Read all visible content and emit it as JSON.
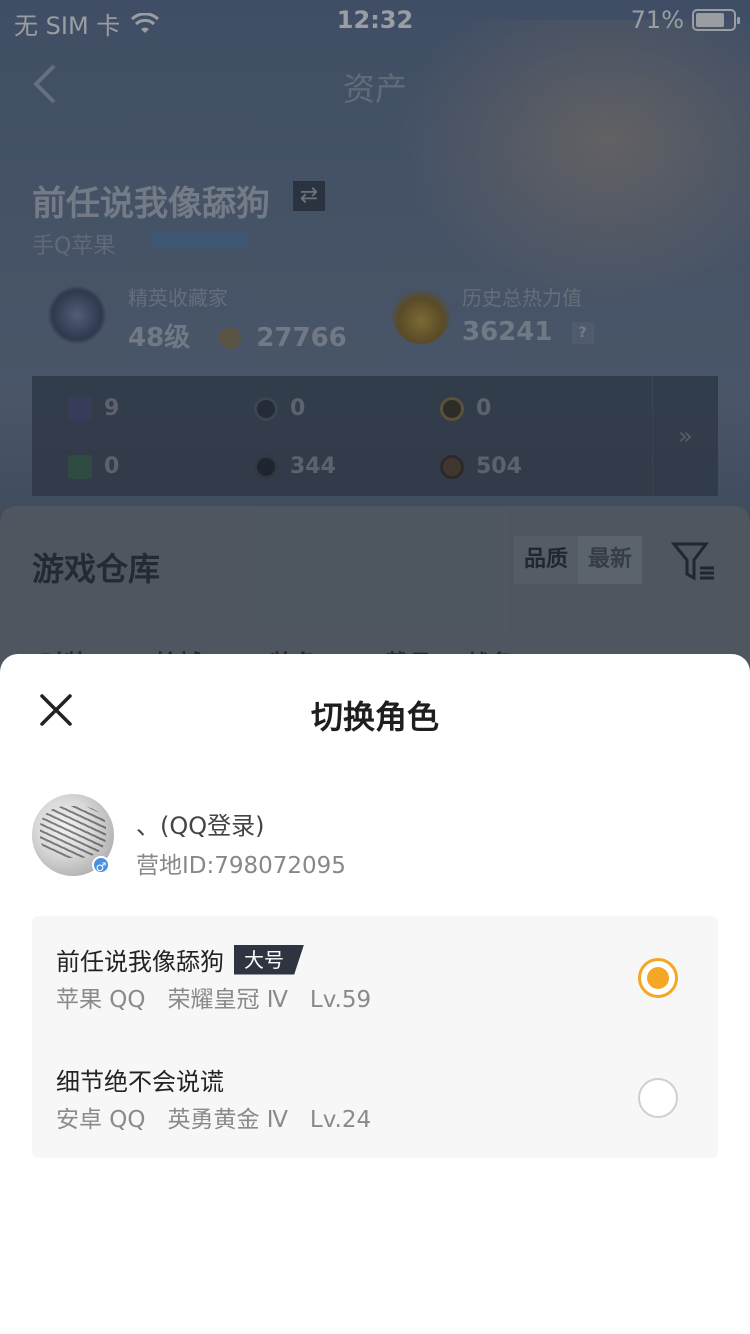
{
  "status_bar": {
    "carrier": "无 SIM 卡",
    "time": "12:32",
    "battery_percent": "71%",
    "battery_level": 0.71
  },
  "nav": {
    "title": "资产",
    "back_icon": "chevron-left-icon"
  },
  "profile": {
    "name": "前任说我像舔狗",
    "platform": "手Q苹果",
    "collector_label": "精英收藏家",
    "collector_level": "48级",
    "collector_points": "27766",
    "heat_label": "历史总热力值",
    "heat_value": "36241",
    "heat_help": "?"
  },
  "assets": {
    "items": [
      {
        "icon": "card-icon",
        "value": "9"
      },
      {
        "icon": "coin-icon",
        "value": "0"
      },
      {
        "icon": "token-icon",
        "value": "0"
      },
      {
        "icon": "ticket-icon",
        "value": "0"
      },
      {
        "icon": "orb-icon",
        "value": "344"
      },
      {
        "icon": "gem-icon",
        "value": "504"
      }
    ],
    "more": "»"
  },
  "warehouse": {
    "title": "游戏仓库",
    "sort_options": [
      "品质",
      "最新"
    ],
    "tabs_text": "时装 360   枪械 103   装备 143   载具 1    战备 86"
  },
  "sheet": {
    "title": "切换角色",
    "account_name": "、(QQ登录)",
    "account_id": "营地ID:798072095",
    "roles": [
      {
        "name": "前任说我像舔狗",
        "tag": "大号",
        "meta": "苹果 QQ   荣耀皇冠 Ⅳ   Lv.59",
        "selected": true
      },
      {
        "name": "细节绝不会说谎",
        "tag": "",
        "meta": "安卓 QQ   英勇黄金 Ⅳ   Lv.24",
        "selected": false
      }
    ]
  },
  "colors": {
    "accent": "#f5a623",
    "sheet_bg": "#ffffff",
    "tag_bg": "#2e3440"
  }
}
